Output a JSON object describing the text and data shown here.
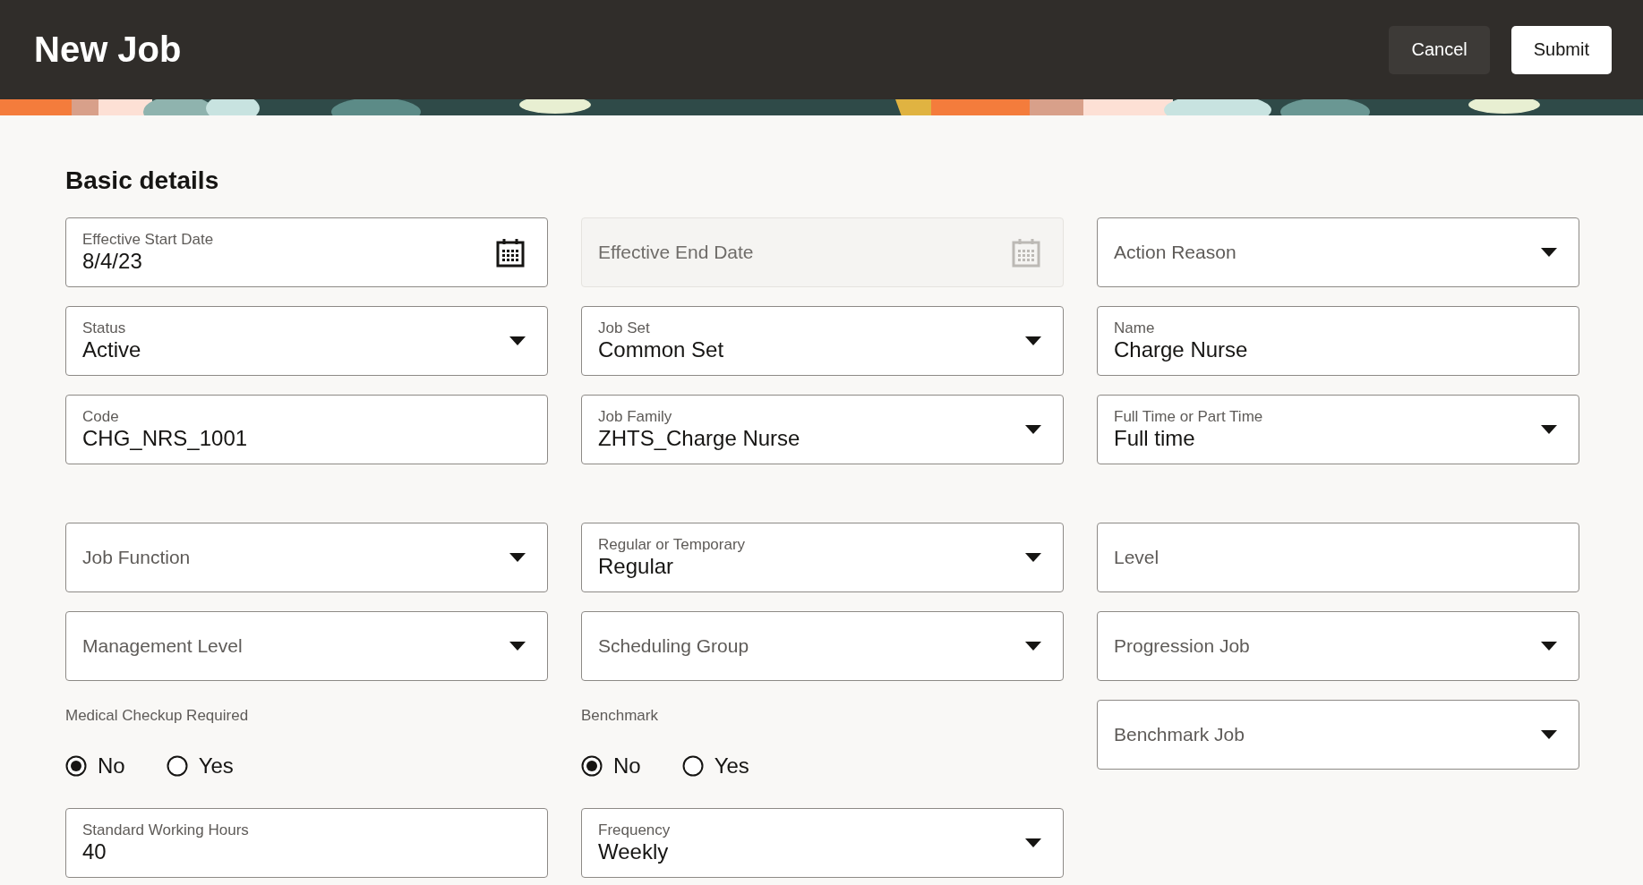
{
  "header": {
    "title": "New Job",
    "buttons": [
      {
        "label": "Cancel",
        "kind": "secondary"
      },
      {
        "label": "Submit",
        "kind": "primary"
      }
    ]
  },
  "section": {
    "title": "Basic details"
  },
  "rows": [
    {
      "cells": [
        {
          "kind": "date",
          "label": "Effective Start Date",
          "value": "8/4/23",
          "disabled": false
        },
        {
          "kind": "date",
          "label": "Effective End Date",
          "disabled": true
        },
        {
          "kind": "select",
          "label": "Action Reason",
          "disabled": false
        }
      ]
    },
    {
      "cells": [
        {
          "kind": "select",
          "label": "Status",
          "value": "Active",
          "disabled": false
        },
        {
          "kind": "select",
          "label": "Job Set",
          "value": "Common Set",
          "disabled": false
        },
        {
          "kind": "text",
          "label": "Name",
          "value": "Charge Nurse",
          "disabled": false
        }
      ]
    },
    {
      "cells": [
        {
          "kind": "text",
          "label": "Code",
          "value": "CHG_NRS_1001",
          "disabled": false
        },
        {
          "kind": "select",
          "label": "Job Family",
          "value": "ZHTS_Charge Nurse",
          "disabled": false
        },
        {
          "kind": "select",
          "label": "Full Time or Part Time",
          "value": "Full time",
          "disabled": false
        }
      ]
    },
    {
      "cells": [
        {
          "kind": "select",
          "label": "Job Function",
          "disabled": false
        },
        {
          "kind": "select",
          "label": "Regular or Temporary",
          "value": "Regular",
          "disabled": false
        },
        {
          "kind": "text",
          "label": "Level",
          "disabled": false
        }
      ]
    },
    {
      "cells": [
        {
          "kind": "select",
          "label": "Management Level",
          "disabled": false
        },
        {
          "kind": "select",
          "label": "Scheduling Group",
          "disabled": false
        },
        {
          "kind": "select",
          "label": "Progression Job",
          "disabled": false
        }
      ]
    },
    {
      "cells": [
        {
          "kind": "radio",
          "label": "Medical Checkup Required",
          "disabled": false,
          "options": [
            {
              "label": "No",
              "selected": true
            },
            {
              "label": "Yes",
              "selected": false
            }
          ]
        },
        {
          "kind": "radio",
          "label": "Benchmark",
          "disabled": false,
          "options": [
            {
              "label": "No",
              "selected": true
            },
            {
              "label": "Yes",
              "selected": false
            }
          ]
        },
        {
          "kind": "select",
          "label": "Benchmark Job",
          "disabled": false
        }
      ]
    },
    {
      "cells": [
        {
          "kind": "text",
          "label": "Standard Working Hours",
          "value": "40",
          "disabled": false
        },
        {
          "kind": "select",
          "label": "Frequency",
          "value": "Weekly",
          "disabled": false
        }
      ]
    }
  ]
}
